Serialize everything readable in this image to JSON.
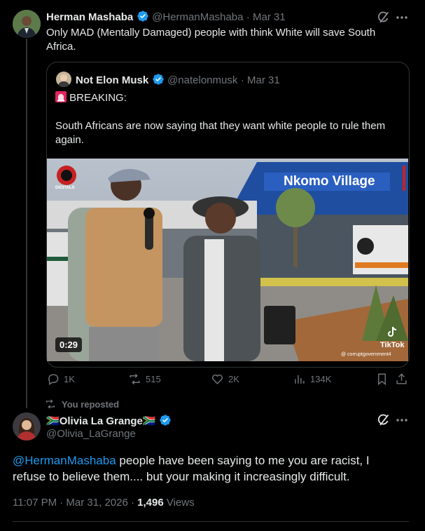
{
  "main_post": {
    "display_name": "Herman Mashaba",
    "handle": "@HermanMashaba",
    "time": "· Mar 31",
    "text": "Only MAD (Mentally Damaged) people with think White will save South Africa."
  },
  "quoted_post": {
    "display_name": "Not Elon Musk",
    "handle": "@natelonmusk",
    "time": "· Mar 31",
    "line1": "BREAKING:",
    "line2": "South Africans are now saying that they want white people to rule them again.",
    "video": {
      "duration": "0:29",
      "sign_text": "Nkomo Village",
      "watermark": "TikTok",
      "watermark_user": "@ corruptgovernment4",
      "logo_text": "DIGITALS"
    }
  },
  "engagement": {
    "replies": "1K",
    "reposts": "515",
    "likes": "2K",
    "views": "134K"
  },
  "repost_label": "You reposted",
  "reply_post": {
    "display_name": "Olivia La Grange",
    "flag_left": "🇿🇦",
    "flag_right": "🇿🇦",
    "handle": "@Olivia_LaGrange",
    "mention": "@HermanMashaba",
    "text": " people have been saying to me you are racist, I refuse to believe them.... but your making it increasingly difficult.",
    "timestamp": "11:07 PM · Mar 31, 2026 · ",
    "views_count": "1,496",
    "views_label": " Views"
  },
  "colors": {
    "background": "#000000",
    "text": "#e7e9ea",
    "muted": "#71767b",
    "accent": "#1d9bf0",
    "border": "#2f3336"
  },
  "icons": [
    "grok-icon",
    "more-icon",
    "verified-icon",
    "siren-icon",
    "reply-icon",
    "repost-icon",
    "like-icon",
    "views-icon",
    "bookmark-icon",
    "share-icon"
  ]
}
